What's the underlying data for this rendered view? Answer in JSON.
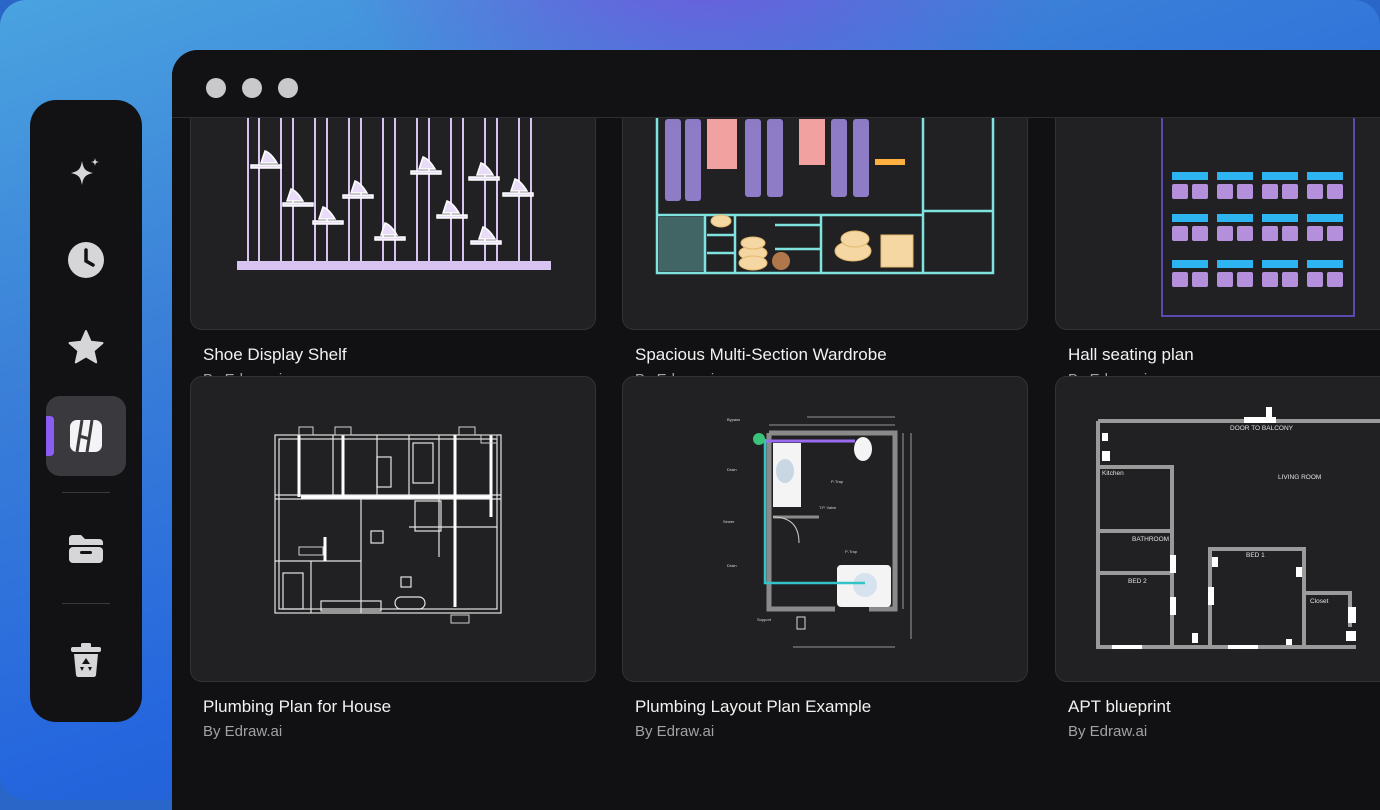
{
  "window": {
    "controls": [
      "close",
      "minimize",
      "maximize"
    ]
  },
  "sidebar": {
    "items": [
      {
        "id": "ai",
        "icon": "sparkle-icon"
      },
      {
        "id": "recent",
        "icon": "clock-icon"
      },
      {
        "id": "favorites",
        "icon": "star-icon"
      },
      {
        "id": "templates",
        "icon": "templates-icon",
        "active": true
      },
      {
        "id": "files",
        "icon": "folder-icon"
      },
      {
        "id": "recycle",
        "icon": "recycle-bin-icon"
      }
    ]
  },
  "templates": [
    {
      "title": "Shoe Display Shelf",
      "author": "By Edraw.ai"
    },
    {
      "title": "Spacious Multi-Section Wardrobe",
      "author": "By Edraw.ai"
    },
    {
      "title": "Hall seating plan",
      "author": "By Edraw.ai"
    },
    {
      "title": "Plumbing Plan for House",
      "author": "By Edraw.ai"
    },
    {
      "title": "Plumbing Layout Plan Example",
      "author": "By Edraw.ai"
    },
    {
      "title": "APT blueprint",
      "author": "By Edraw.ai"
    }
  ],
  "blueprint_labels": {
    "door": "DOOR TO BALCONY",
    "living": "LIVING ROOM",
    "kitchen": "Kitchen",
    "bathroom": "BATHROOM",
    "bed1": "BED 1",
    "bed2": "BED 2",
    "closet": "Closet"
  },
  "colors": {
    "accent": "#8b5cf6",
    "shelf_lilac": "#d7c4f0",
    "wardrobe_cyan": "#7fe3e0",
    "seat_blue": "#2fb4f2",
    "seat_purple": "#b490dc"
  }
}
